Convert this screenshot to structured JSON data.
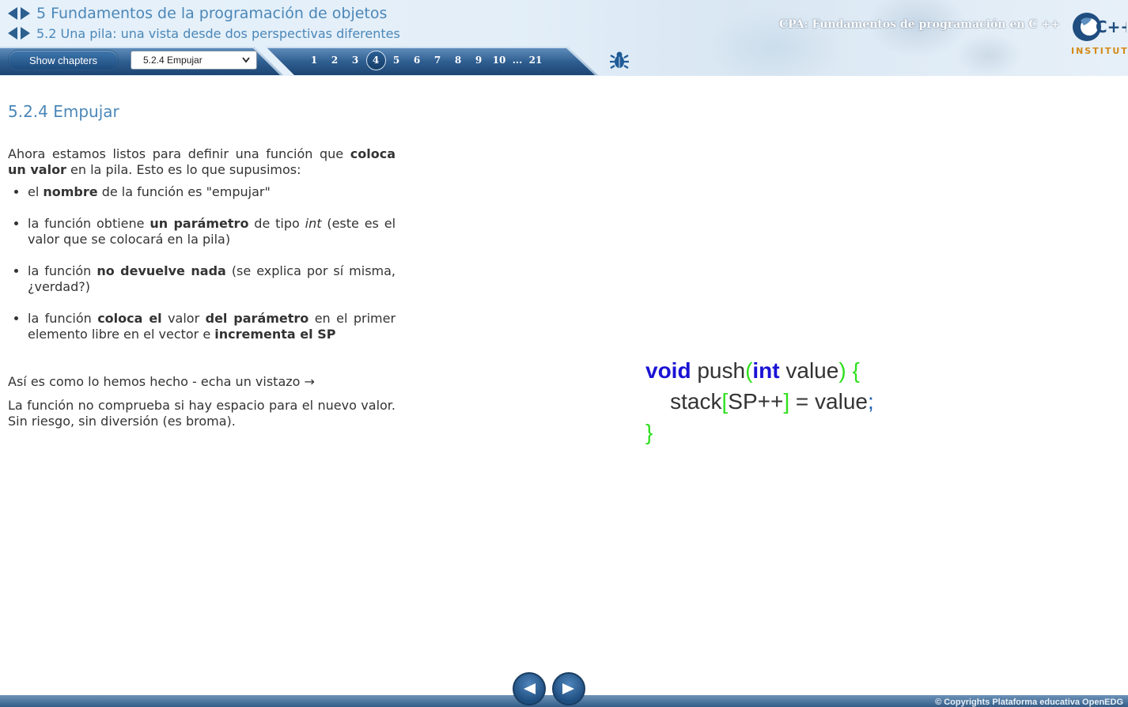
{
  "header": {
    "chapter_title": "5 Fundamentos de la programación de objetos",
    "section_title": "5.2 Una pila: una vista desde dos perspectivas diferentes",
    "course_title": "CPA: Fundamentos de programación en C ++",
    "logo_text": "C++",
    "logo_subtext": "INSTITUTE"
  },
  "toolbar": {
    "show_chapters_label": "Show chapters",
    "chapter_select_value": "5.2.4 Empujar",
    "pages": [
      "1",
      "2",
      "3",
      "4",
      "5",
      "6",
      "7",
      "8",
      "9",
      "10"
    ],
    "active_page": "4",
    "ellipsis": "...",
    "last_page": "21"
  },
  "content": {
    "title": "5.2.4 Empujar",
    "intro": {
      "t1": "Ahora estamos listos para definir una función que ",
      "b1": "coloca un valor",
      "t2": " en la pila. Esto es lo que supusimos:"
    },
    "bullets": [
      {
        "t1": "el ",
        "b1": "nombre",
        "t2": " de la función es \"empujar\""
      },
      {
        "t1": "la función obtiene ",
        "b1": "un parámetro",
        "t2": " de tipo ",
        "i1": "int",
        "t3": " (este es el valor que se colocará en la pila)"
      },
      {
        "t1": "la función ",
        "b1": "no devuelve nada",
        "t2": " (se explica por sí misma, ¿verdad?)"
      },
      {
        "t1": "la función ",
        "b1": "coloca el",
        "t2": " valor ",
        "b2": "del parámetro",
        "t3": " en el primer elemento libre en el vector e ",
        "b3": "incrementa el SP"
      }
    ],
    "para1": "Así es como lo hemos hecho - echa un vistazo →",
    "para2": "La función no comprueba si hay espacio para el nuevo valor. Sin riesgo, sin diversión (es broma)."
  },
  "code": {
    "l1_kw1": "void",
    "l1_t1": " push",
    "l1_p1": "(",
    "l1_kw2": "int",
    "l1_t2": " value",
    "l1_p2": ")",
    "l1_sp": " ",
    "l1_b1": "{",
    "l2_indent": "    ",
    "l2_t1": "stack",
    "l2_b1": "[",
    "l2_t2": "SP++",
    "l2_b2": "]",
    "l2_t3": " = value",
    "l2_sc": ";",
    "l3_b1": "}"
  },
  "footer": {
    "copyright": "© Copyrights Plataforma educativa OpenEDG"
  },
  "colors": {
    "accent_blue": "#4b87b8",
    "keyword": "#1a13d4",
    "bracket": "#2ee01f",
    "toolbar_dark": "#1f4c7c"
  }
}
